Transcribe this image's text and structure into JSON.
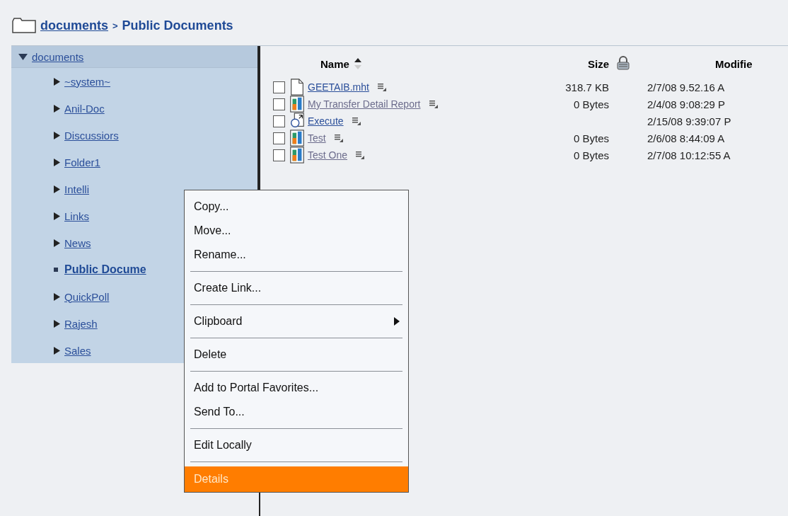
{
  "breadcrumb": {
    "parent": "documents",
    "separator": ">",
    "current": "Public Documents"
  },
  "sidebar": {
    "root": {
      "label": "documents",
      "expanded": true
    },
    "items": [
      {
        "label": "~system~",
        "selected": false
      },
      {
        "label": "Anil-Doc",
        "selected": false
      },
      {
        "label": "Discussiors",
        "selected": false
      },
      {
        "label": "Folder1",
        "selected": false
      },
      {
        "label": "Intelli",
        "selected": false
      },
      {
        "label": "Links",
        "selected": false
      },
      {
        "label": "News",
        "selected": false
      },
      {
        "label": "Public Docume",
        "selected": true
      },
      {
        "label": "QuickPoll",
        "selected": false
      },
      {
        "label": "Rajesh",
        "selected": false
      },
      {
        "label": "Sales",
        "selected": false
      }
    ]
  },
  "table": {
    "columns": [
      {
        "label": "Name",
        "sorted": true
      },
      {
        "label": "Size",
        "sorted": false
      },
      {
        "label": "Modifie",
        "sorted": false
      }
    ],
    "rows": [
      {
        "kind": "document",
        "name": "GEETAIB.mht",
        "visited": false,
        "checked": false,
        "size": "318.7 KB",
        "modified": "2/7/08 9.52.16 A"
      },
      {
        "kind": "report",
        "name": "My Transfer Detail Report",
        "visited": true,
        "checked": false,
        "size": "0 Bytes",
        "modified": "2/4/08 9:08:29 P"
      },
      {
        "kind": "link",
        "name": "Execute",
        "visited": false,
        "checked": false,
        "modified": "2/15/08 9:39:07 P"
      },
      {
        "kind": "report",
        "name": "Test",
        "visited": true,
        "checked": false,
        "size": "0 Bytes",
        "modified": "2/6/08 8:44:09 A"
      },
      {
        "kind": "report",
        "name": "Test One",
        "visited": true,
        "checked": false,
        "size": "0 Bytes",
        "modified": "2/7/08 10:12:55 A"
      }
    ]
  },
  "context_menu": {
    "groups": [
      [
        {
          "label": "Copy...",
          "selected": false
        },
        {
          "label": "Move...",
          "selected": false
        },
        {
          "label": "Rename...",
          "selected": false
        }
      ],
      [
        {
          "label": "Create Link...",
          "selected": false
        }
      ],
      [
        {
          "label": "Clipboard",
          "selected": false,
          "submenu": true
        }
      ],
      [
        {
          "label": "Delete",
          "selected": false
        }
      ],
      [
        {
          "label": "Add to Portal Favorites...",
          "selected": false
        },
        {
          "label": "Send To...",
          "selected": false
        }
      ],
      [
        {
          "label": "Edit Locally",
          "selected": false
        }
      ],
      [
        {
          "label": "Details",
          "selected": true
        }
      ]
    ]
  }
}
